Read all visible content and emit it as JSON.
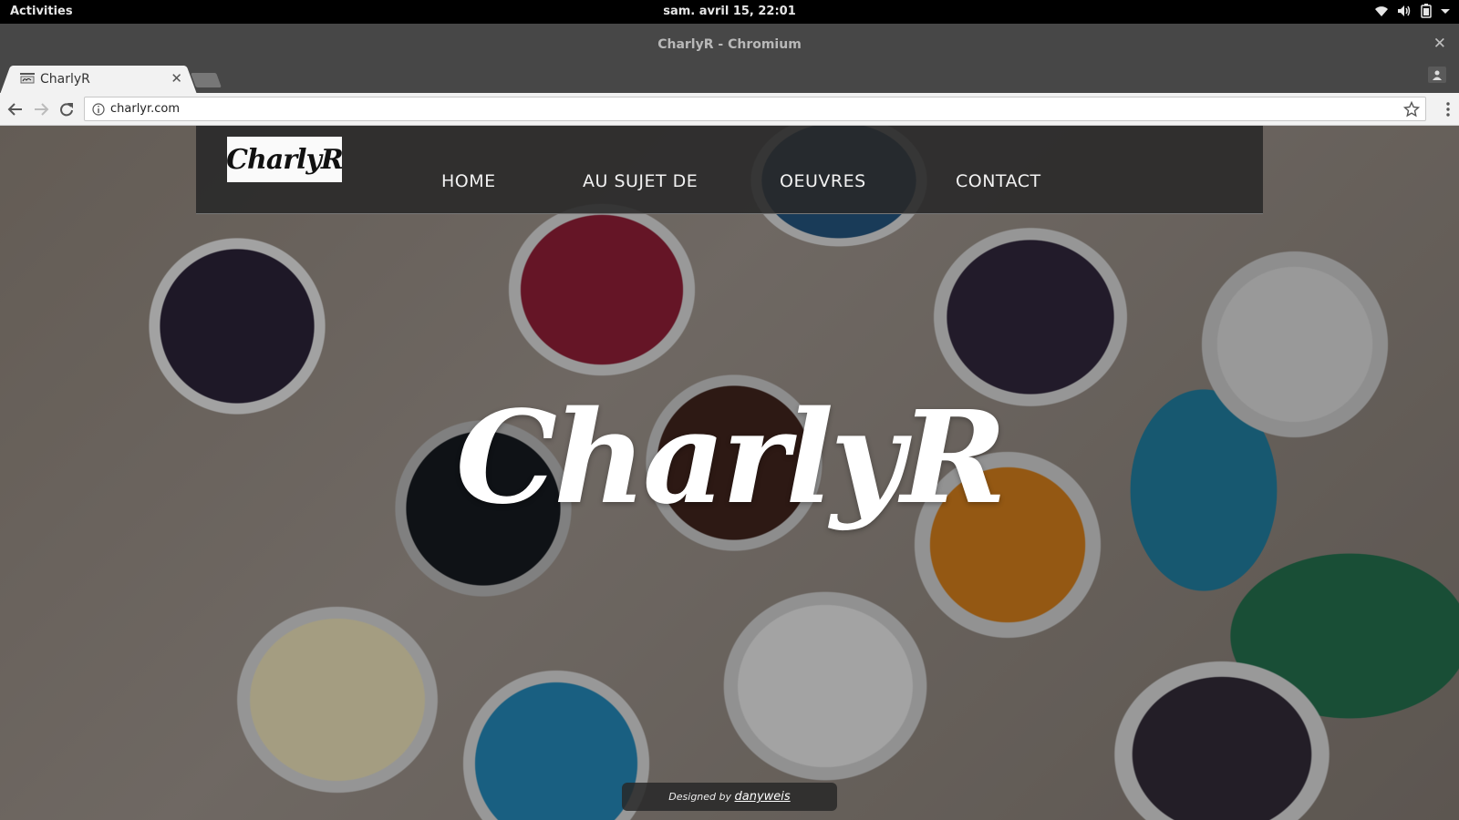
{
  "system_bar": {
    "activities": "Activities",
    "clock": "sam. avril 15, 22:01"
  },
  "window": {
    "title": "CharlyR - Chromium",
    "close_glyph": "✕"
  },
  "tabs": [
    {
      "label": "CharlyR",
      "close_glyph": "✕"
    }
  ],
  "address_bar": {
    "url": "charlyr.com"
  },
  "site": {
    "logo_text": "CharlyR",
    "nav": [
      "HOME",
      "AU SUJET DE",
      "OEUVRES",
      "CONTACT"
    ],
    "hero_title": "CharlyR",
    "footer": {
      "prefix": "Designed by",
      "author": "danyweis"
    }
  },
  "colors": {
    "system_bar_bg": "#000000",
    "titlebar_bg": "#474747",
    "toolbar_bg": "#f2f2f2",
    "navbar_bg": "#282828",
    "hero_text": "#ffffff"
  },
  "icons": {
    "system_status": [
      "wifi-icon",
      "volume-icon",
      "battery-icon",
      "dropdown-arrow-icon"
    ],
    "toolbar": [
      "back-icon",
      "forward-icon",
      "reload-icon",
      "site-info-icon",
      "bookmark-star-icon",
      "menu-icon"
    ]
  }
}
